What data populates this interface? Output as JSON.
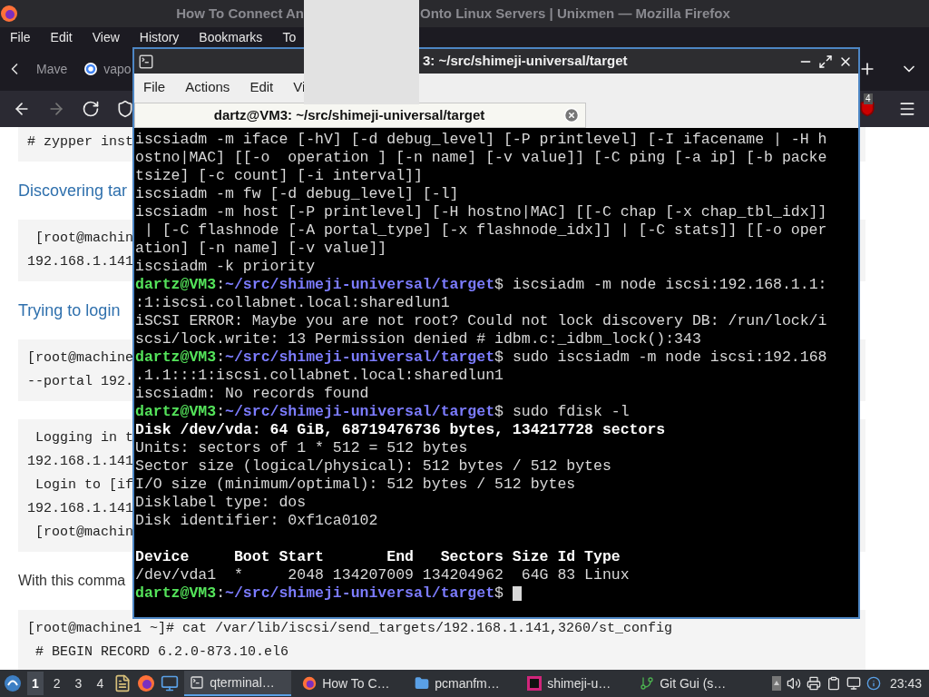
{
  "browser": {
    "title_left": "How To Connect An",
    "title_right": "Onto Linux Servers | Unixmen — Mozilla Firefox",
    "menu": [
      "File",
      "Edit",
      "View",
      "History",
      "Bookmarks",
      "To"
    ],
    "tabs": [
      {
        "label": "Mave",
        "selected": false
      },
      {
        "label": "vapo",
        "selected": false
      }
    ],
    "extension_badge": "4",
    "page": [
      {
        "kind": "code",
        "lines": [
          "# zypper inst"
        ]
      },
      {
        "kind": "heading",
        "text": "Discovering tar"
      },
      {
        "kind": "code",
        "lines": [
          " [root@machin",
          "192.168.1.141"
        ]
      },
      {
        "kind": "heading",
        "text": "Trying to login"
      },
      {
        "kind": "code",
        "lines": [
          "[root@machine",
          "--portal 192."
        ]
      },
      {
        "kind": "code",
        "lines": [
          " Logging in t",
          "192.168.1.141",
          " Login to [if",
          "192.168.1.141",
          " [root@machin"
        ]
      },
      {
        "kind": "paragraph",
        "text": "With this comma"
      },
      {
        "kind": "code",
        "lines": [
          "[root@machine1 ~]# cat /var/lib/iscsi/send_targets/192.168.1.141,3260/st_config",
          " # BEGIN RECORD 6.2.0-873.10.el6"
        ]
      }
    ]
  },
  "terminal": {
    "title": "3: ~/src/shimeji-universal/target",
    "menu": [
      "File",
      "Actions",
      "Edit",
      "Vi"
    ],
    "tab": {
      "label": "dartz@VM3: ~/src/shimeji-universal/target",
      "selected": true
    },
    "lines": [
      {
        "kind": "output",
        "text": "iscsiadm -m iface [-hV] [-d debug_level] [-P printlevel] [-I ifacename | -H h"
      },
      {
        "kind": "output",
        "text": "ostno|MAC] [[-o  operation ] [-n name] [-v value]] [-C ping [-a ip] [-b packe"
      },
      {
        "kind": "output",
        "text": "tsize] [-c count] [-i interval]]"
      },
      {
        "kind": "output",
        "text": "iscsiadm -m fw [-d debug_level] [-l]"
      },
      {
        "kind": "output",
        "text": "iscsiadm -m host [-P printlevel] [-H hostno|MAC] [[-C chap [-x chap_tbl_idx]]"
      },
      {
        "kind": "output",
        "text": " | [-C flashnode [-A portal_type] [-x flashnode_idx]] | [-C stats]] [[-o oper"
      },
      {
        "kind": "output",
        "text": "ation] [-n name] [-v value]]"
      },
      {
        "kind": "output",
        "text": "iscsiadm -k priority"
      },
      {
        "kind": "prompt",
        "user": "dartz@VM3",
        "sep": ":",
        "path": "~/src/shimeji-universal/target",
        "text": "$ iscsiadm -m node iscsi:192.168.1.1:"
      },
      {
        "kind": "output",
        "text": ":1:iscsi.collabnet.local:sharedlun1"
      },
      {
        "kind": "output",
        "text": "iSCSI ERROR: Maybe you are not root? Could not lock discovery DB: /run/lock/i"
      },
      {
        "kind": "output",
        "text": "scsi/lock.write: 13 Permission denied # idbm.c:_idbm_lock():343"
      },
      {
        "kind": "prompt",
        "user": "dartz@VM3",
        "sep": ":",
        "path": "~/src/shimeji-universal/target",
        "text": "$ sudo iscsiadm -m node iscsi:192.168"
      },
      {
        "kind": "output",
        "text": ".1.1:::1:iscsi.collabnet.local:sharedlun1"
      },
      {
        "kind": "output",
        "text": "iscsiadm: No records found"
      },
      {
        "kind": "prompt",
        "user": "dartz@VM3",
        "sep": ":",
        "path": "~/src/shimeji-universal/target",
        "text": "$ sudo fdisk -l"
      },
      {
        "kind": "bold",
        "text": "Disk /dev/vda: 64 GiB, 68719476736 bytes, 134217728 sectors"
      },
      {
        "kind": "output",
        "text": "Units: sectors of 1 * 512 = 512 bytes"
      },
      {
        "kind": "output",
        "text": "Sector size (logical/physical): 512 bytes / 512 bytes"
      },
      {
        "kind": "output",
        "text": "I/O size (minimum/optimal): 512 bytes / 512 bytes"
      },
      {
        "kind": "output",
        "text": "Disklabel type: dos"
      },
      {
        "kind": "output",
        "text": "Disk identifier: 0xf1ca0102"
      },
      {
        "kind": "blank"
      },
      {
        "kind": "bold",
        "text": "Device     Boot Start       End   Sectors Size Id Type"
      },
      {
        "kind": "output",
        "text": "/dev/vda1  *     2048 134207009 134204962  64G 83 Linux"
      },
      {
        "kind": "prompt",
        "user": "dartz@VM3",
        "sep": ":",
        "path": "~/src/shimeji-universal/target",
        "text": "$",
        "cursor": true
      }
    ]
  },
  "taskbar": {
    "workspaces": [
      {
        "label": "1",
        "selected": true
      },
      {
        "label": "2",
        "selected": false
      },
      {
        "label": "3",
        "selected": false
      },
      {
        "label": "4",
        "selected": false
      }
    ],
    "tasks": [
      {
        "label": "qterminal…",
        "kind": "terminal",
        "selected": true
      },
      {
        "label": "How To C…",
        "kind": "browser",
        "selected": false
      },
      {
        "label": "pcmanfm…",
        "kind": "folder",
        "selected": false
      },
      {
        "label": "shimeji-u…",
        "kind": "ide",
        "selected": false
      },
      {
        "label": "Git Gui (s…",
        "kind": "git",
        "selected": false
      }
    ],
    "clock": "23:43"
  }
}
